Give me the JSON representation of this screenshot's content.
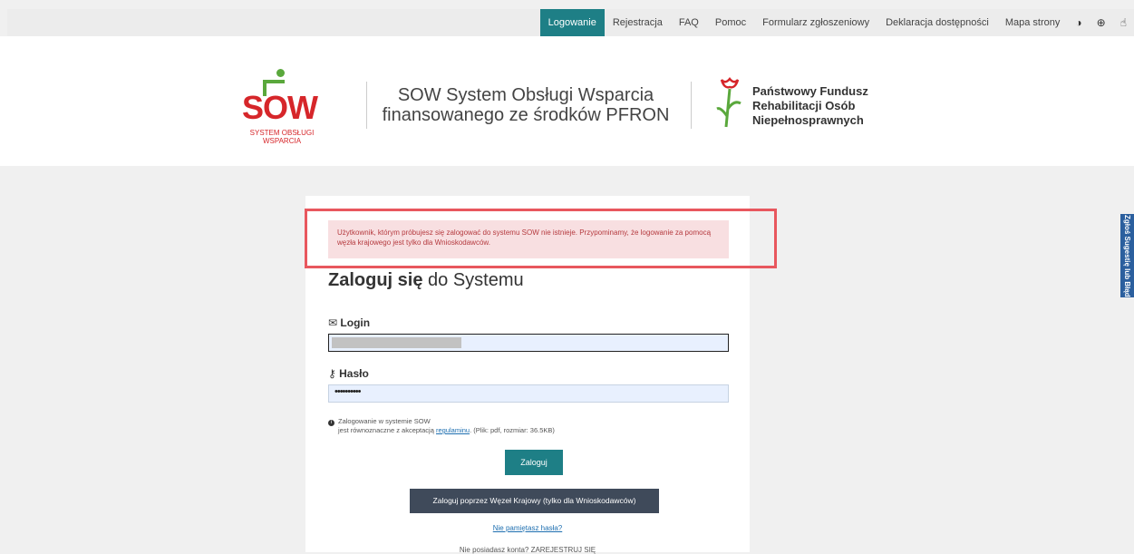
{
  "nav": {
    "items": [
      {
        "label": "Logowanie",
        "active": true
      },
      {
        "label": "Rejestracja",
        "active": false
      },
      {
        "label": "FAQ",
        "active": false
      },
      {
        "label": "Pomoc",
        "active": false
      },
      {
        "label": "Formularz zgłoszeniowy",
        "active": false
      },
      {
        "label": "Deklaracja dostępności",
        "active": false
      },
      {
        "label": "Mapa strony",
        "active": false
      }
    ],
    "tools": {
      "contrast": "◑",
      "zoom": "⊕",
      "sign": "☝"
    }
  },
  "header": {
    "sow_letters": {
      "s": "S",
      "o": "O",
      "w": "W"
    },
    "sow_subtitle_1": "SYSTEM OBSŁUGI",
    "sow_subtitle_2": "WSPARCIA",
    "title_line_1": "SOW System Obsługi Wsparcia",
    "title_line_2": "finansowanego ze środków PFRON",
    "pfron_line_1": "Państwowy Fundusz",
    "pfron_line_2": "Rehabilitacji Osób",
    "pfron_line_3": "Niepełnosprawnych"
  },
  "alert": {
    "text": "Użytkownik, którym próbujesz się zalogować do systemu SOW nie istnieje. Przypominamy, że logowanie za pomocą węzła krajowego jest tylko dla Wnioskodawców."
  },
  "login": {
    "title_bold": "Zaloguj się",
    "title_rest": " do Systemu",
    "login_label": "Login",
    "login_value": "",
    "password_label": "Hasło",
    "password_value": "••••••••••",
    "info_line_1": "Zalogowanie w systemie SOW",
    "info_line_2_pre": "jest równoznaczne z akceptacją ",
    "info_link": "regulaminu",
    "info_line_2_post": ". (Plik: pdf, rozmiar: 36.5KB)",
    "submit_label": "Zaloguj",
    "wezel_label": "Zaloguj poprzez Węzeł Krajowy (tylko dla Wnioskodawców)",
    "forgot_label": "Nie pamiętasz hasła?",
    "register_label": "Nie posiadasz konta? ZAREJESTRUJ SIĘ"
  },
  "side_tab": {
    "label": "Zgłoś Sugestię lub Błąd"
  },
  "colors": {
    "accent": "#1e7f86",
    "alert_border": "#e8575e",
    "alert_bg": "#f8dfe1",
    "sow_red": "#d6262a",
    "sow_green": "#5aa83c"
  }
}
